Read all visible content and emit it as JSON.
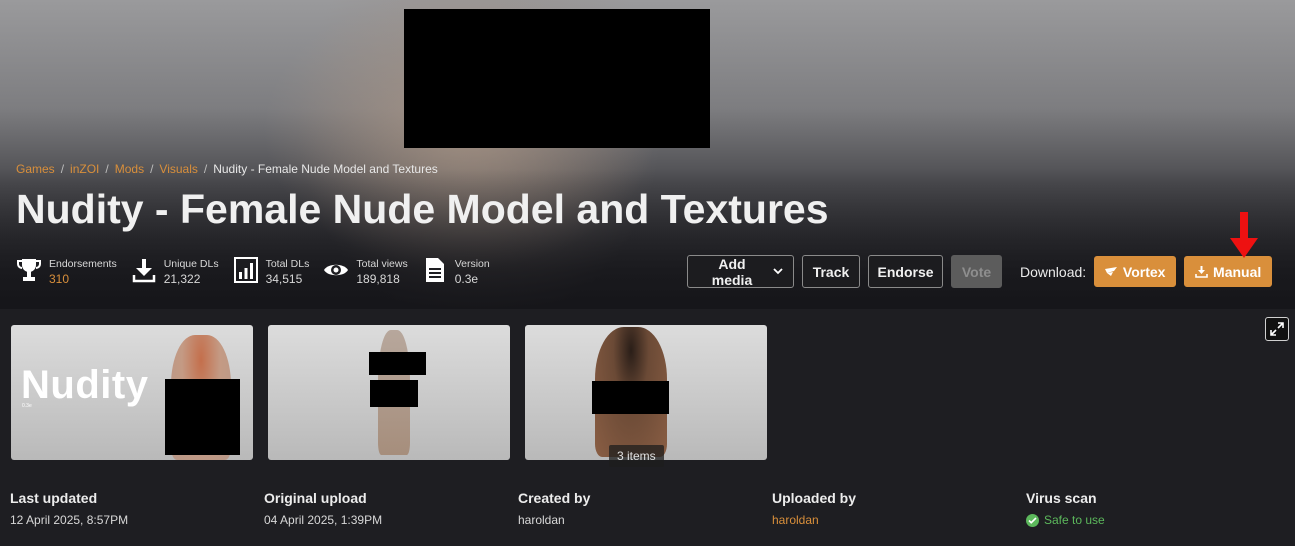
{
  "breadcrumb": [
    "Games",
    "inZOI",
    "Mods",
    "Visuals",
    "Nudity - Female Nude Model and Textures"
  ],
  "title": "Nudity - Female Nude Model and Textures",
  "stats": [
    {
      "label": "Endorsements",
      "value": "310",
      "icon": "trophy-icon"
    },
    {
      "label": "Unique DLs",
      "value": "21,322",
      "icon": "download-icon"
    },
    {
      "label": "Total DLs",
      "value": "34,515",
      "icon": "bar-chart-icon"
    },
    {
      "label": "Total views",
      "value": "189,818",
      "icon": "eye-icon"
    },
    {
      "label": "Version",
      "value": "0.3e",
      "icon": "document-icon"
    }
  ],
  "actions": {
    "add_media": "Add media",
    "track": "Track",
    "endorse": "Endorse",
    "vote": "Vote"
  },
  "download": {
    "label": "Download:",
    "vortex": "Vortex",
    "manual": "Manual"
  },
  "gallery": {
    "thumb1_text": "Nudity",
    "thumb1_small": "0.3e",
    "items_badge": "3 items"
  },
  "meta": {
    "last_updated_label": "Last updated",
    "last_updated": "12 April 2025, 8:57PM",
    "original_upload_label": "Original upload",
    "original_upload": "04 April 2025, 1:39PM",
    "created_by_label": "Created by",
    "created_by": "haroldan",
    "uploaded_by_label": "Uploaded by",
    "uploaded_by": "haroldan",
    "virus_scan_label": "Virus scan",
    "virus_scan": "Safe to use"
  },
  "colors": {
    "accent": "#d98f3b",
    "safe": "#5cb85c",
    "background": "#1e1e22"
  }
}
